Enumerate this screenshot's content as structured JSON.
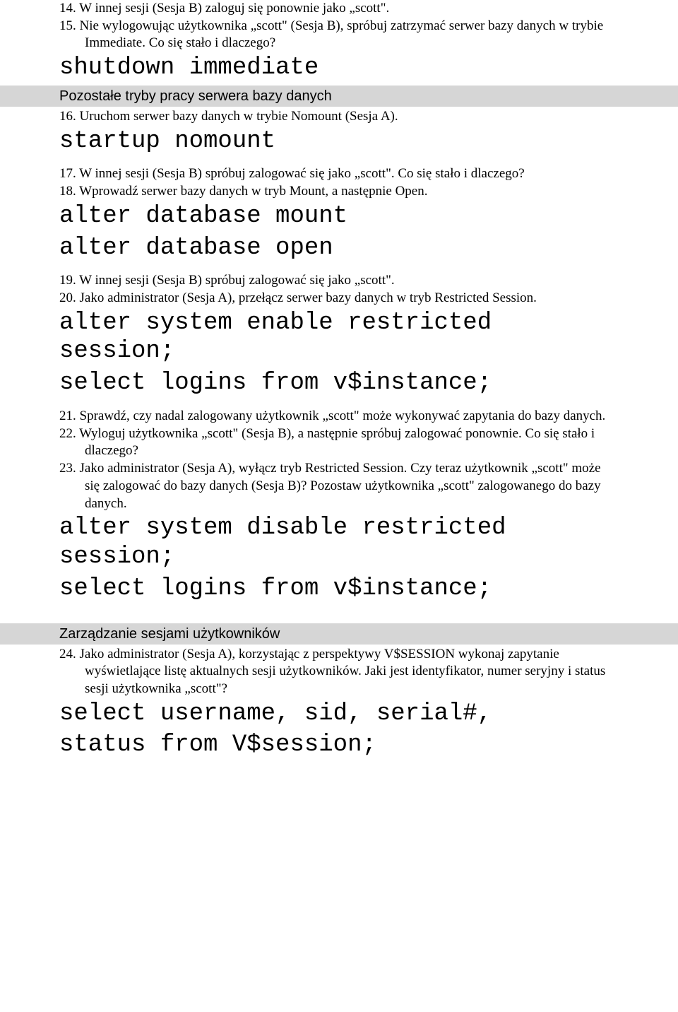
{
  "items": {
    "i14": {
      "num": "14.",
      "text": "W innej sesji (Sesja B) zaloguj się ponownie jako „scott\"."
    },
    "i15": {
      "num": "15.",
      "text": "Nie wylogowując użytkownika „scott\" (Sesja B), spróbuj zatrzymać serwer bazy danych w trybie Immediate. Co się stało i dlaczego?"
    },
    "i16": {
      "num": "16.",
      "text": "Uruchom serwer bazy danych w trybie Nomount (Sesja A)."
    },
    "i17": {
      "num": "17.",
      "text": "W innej sesji (Sesja B) spróbuj zalogować się jako „scott\". Co się stało i dlaczego?"
    },
    "i18": {
      "num": "18.",
      "text": "Wprowadź serwer bazy danych w tryb Mount, a następnie Open."
    },
    "i19": {
      "num": "19.",
      "text": "W innej sesji (Sesja B) spróbuj zalogować się jako „scott\"."
    },
    "i20": {
      "num": "20.",
      "text": "Jako administrator (Sesja A), przełącz serwer bazy danych w tryb Restricted Session."
    },
    "i21": {
      "num": "21.",
      "text": "Sprawdź, czy nadal zalogowany użytkownik „scott\" może wykonywać zapytania do bazy danych."
    },
    "i22": {
      "num": "22.",
      "text": "Wyloguj użytkownika „scott\" (Sesja B), a następnie spróbuj zalogować ponownie. Co się stało i dlaczego?"
    },
    "i23": {
      "num": "23.",
      "text": "Jako administrator (Sesja A), wyłącz tryb Restricted Session. Czy teraz użytkownik „scott\" może się zalogować do bazy danych (Sesja B)? Pozostaw użytkownika „scott\" zalogowanego do bazy danych."
    },
    "i24": {
      "num": "24.",
      "text": "Jako administrator (Sesja A), korzystając z perspektywy V$SESSION wykonaj zapytanie wyświetlające listę aktualnych sesji użytkowników. Jaki jest identyfikator, numer seryjny i status sesji użytkownika „scott\"?"
    }
  },
  "code": {
    "c1": "shutdown immediate",
    "c2": "startup nomount",
    "c3a": "alter database mount",
    "c3b": "alter database open",
    "c4a": "alter system enable restricted session;",
    "c4b": "select logins from v$instance;",
    "c5a": "alter system disable restricted session;",
    "c5b": "select logins from v$instance;",
    "c6a": "select username, sid, serial#,",
    "c6b": "status from V$session;"
  },
  "sections": {
    "s1": "Pozostałe tryby pracy serwera bazy danych",
    "s2": "Zarządzanie sesjami użytkowników"
  }
}
